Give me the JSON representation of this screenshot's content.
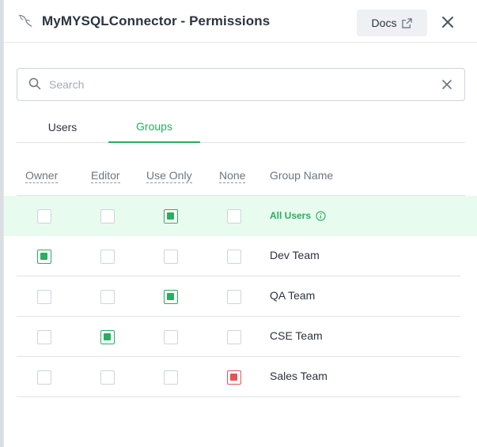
{
  "header": {
    "title": "MyMYSQLConnector - Permissions",
    "docs_label": "Docs",
    "icons": {
      "app": "mysql-dolphin-icon",
      "docs": "external-link-icon",
      "close": "close-icon"
    }
  },
  "search": {
    "placeholder": "Search",
    "value": ""
  },
  "tabs": [
    {
      "label": "Users",
      "active": false
    },
    {
      "label": "Groups",
      "active": true
    }
  ],
  "columns": {
    "owner": "Owner",
    "editor": "Editor",
    "use_only": "Use Only",
    "none": "None",
    "group_name": "Group Name"
  },
  "rows": [
    {
      "name": "All Users",
      "permission": "use_only",
      "special": true,
      "info_icon": "info-icon"
    },
    {
      "name": "Dev Team",
      "permission": "owner",
      "special": false
    },
    {
      "name": "QA Team",
      "permission": "use_only",
      "special": false
    },
    {
      "name": "CSE Team",
      "permission": "editor",
      "special": false
    },
    {
      "name": "Sales Team",
      "permission": "none",
      "special": false
    }
  ],
  "colors": {
    "accent": "#27ae60",
    "none_selected": "#e05555",
    "highlight_row": "#e8fbef"
  }
}
